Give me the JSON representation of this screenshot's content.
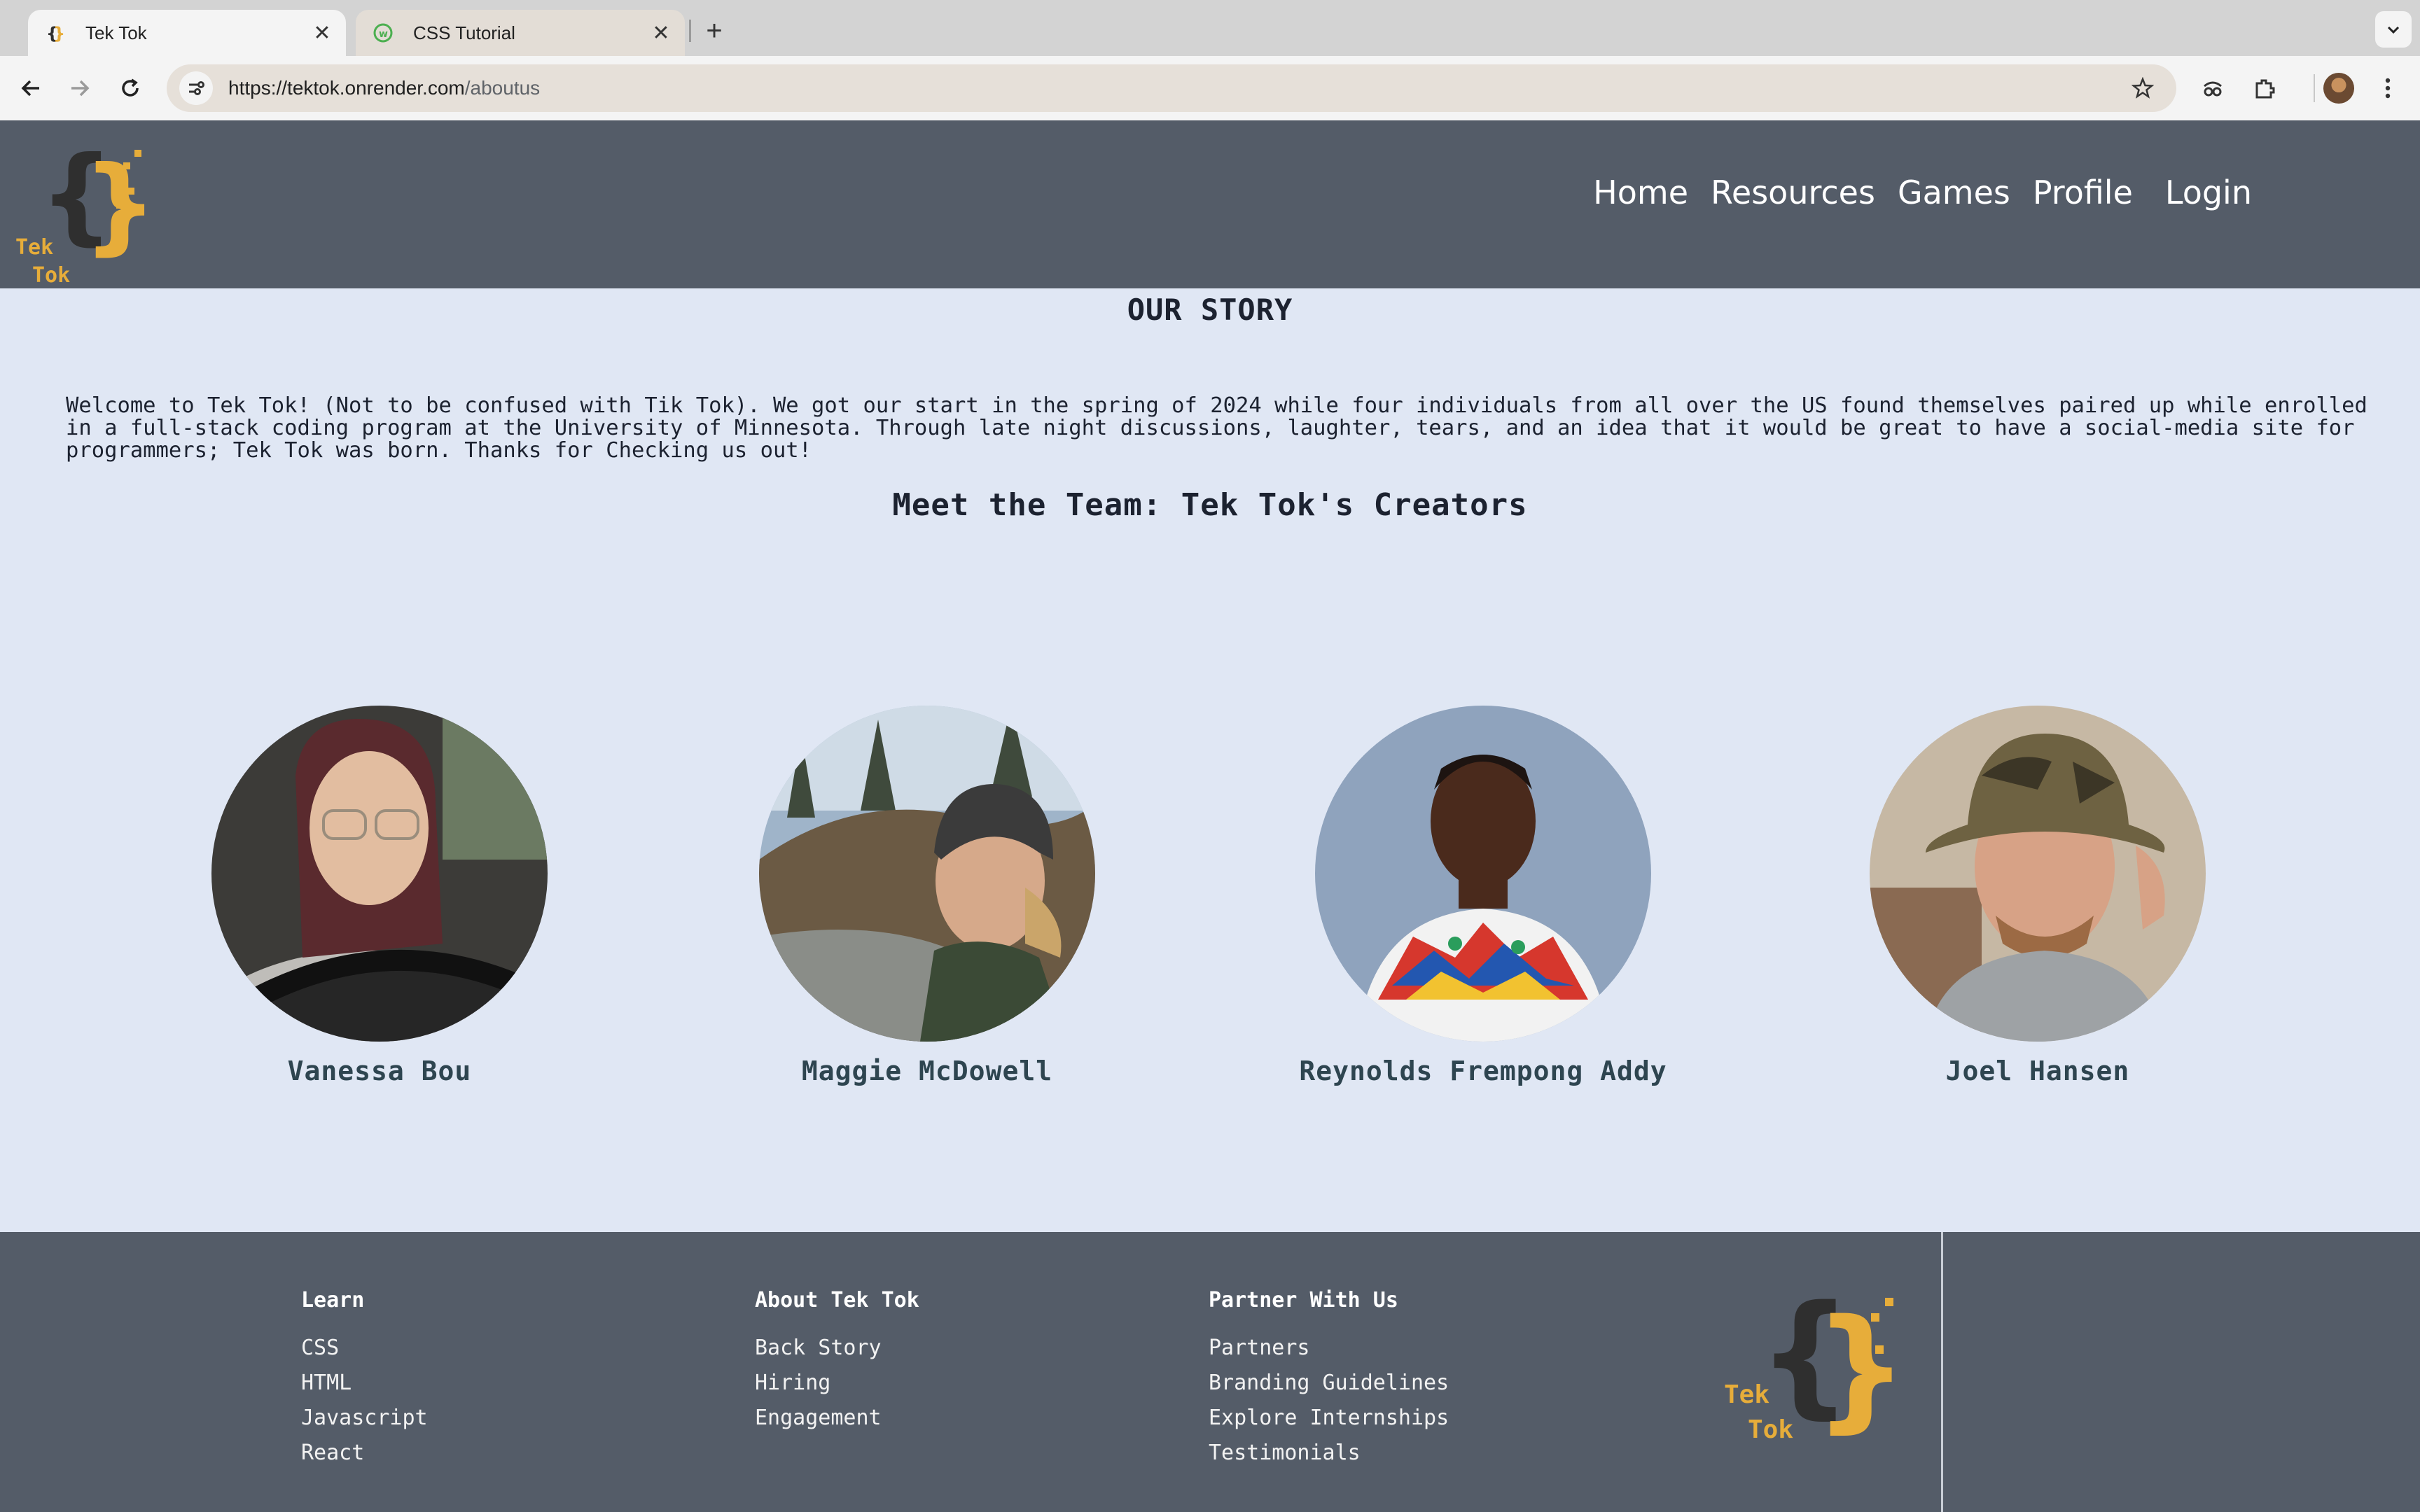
{
  "browser": {
    "tabs": [
      {
        "title": "Tek Tok",
        "active": true,
        "favicon": "tektok-favicon-icon"
      },
      {
        "title": "CSS Tutorial",
        "active": false,
        "favicon": "w3-favicon-icon"
      }
    ],
    "url_host": "https://tektok.onrender.com",
    "url_path": "/aboutus"
  },
  "header": {
    "logo_word_1": "Tek",
    "logo_word_2": "Tok",
    "nav": [
      {
        "label": "Home"
      },
      {
        "label": "Resources"
      },
      {
        "label": "Games"
      },
      {
        "label": "Profile"
      },
      {
        "label": "Login"
      }
    ]
  },
  "main": {
    "story_heading": "OUR STORY",
    "story_text": "Welcome to Tek Tok! (Not to be confused with Tik Tok). We got our start in the spring of 2024 while four individuals from all over the US found themselves paired up while enrolled in a full-stack coding program at the University of Minnesota. Through late night discussions, laughter, tears, and an idea that it would be great to have a social-media site for programmers; Tek Tok was born. Thanks for Checking us out!",
    "team_heading": "Meet the Team: Tek Tok's Creators",
    "team": [
      {
        "name": "Vanessa Bou"
      },
      {
        "name": "Maggie McDowell"
      },
      {
        "name": "Reynolds Frempong Addy"
      },
      {
        "name": "Joel Hansen"
      }
    ]
  },
  "footer": {
    "columns": [
      {
        "heading": "Learn",
        "links": [
          "CSS",
          "HTML",
          "Javascript",
          "React"
        ]
      },
      {
        "heading": "About Tek Tok",
        "links": [
          "Back Story",
          "Hiring",
          "Engagement"
        ]
      },
      {
        "heading": "Partner With Us",
        "links": [
          "Partners",
          "Branding Guidelines",
          "Explore Internships",
          "Testimonials"
        ]
      }
    ],
    "logo_word_1": "Tek",
    "logo_word_2": "Tok"
  },
  "colors": {
    "header_bg": "#545c68",
    "page_bg": "#e0e7f4",
    "brand_yellow": "#e7ad3a",
    "brand_dark": "#2f2f2f"
  }
}
